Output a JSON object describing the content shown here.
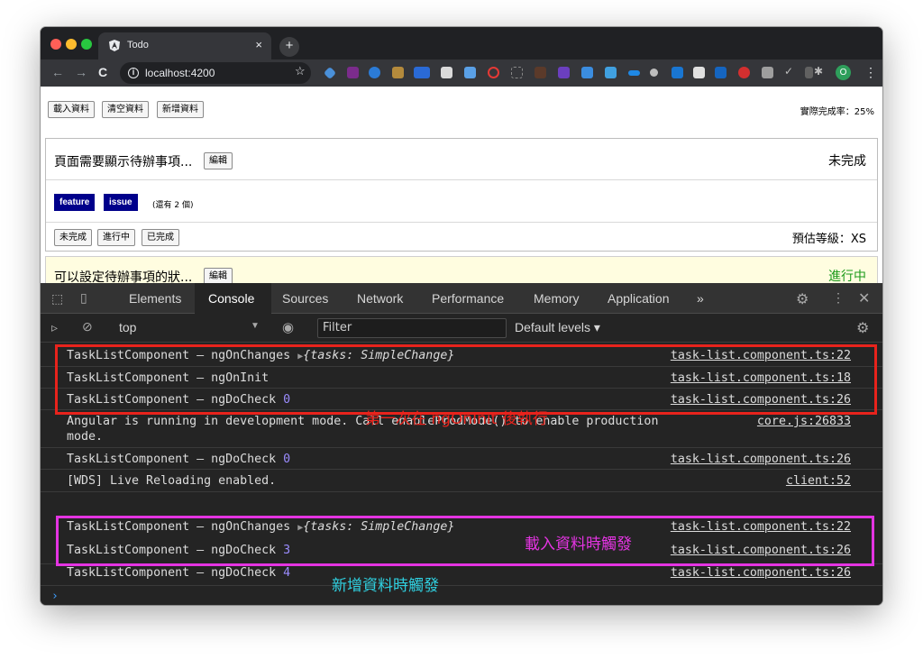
{
  "browser": {
    "tab_title": "Todo",
    "tab_close": "×",
    "new_tab": "+",
    "url": "localhost:4200",
    "avatar_letter": "O",
    "nav": {
      "back": "←",
      "forward": "→",
      "reload": "C"
    }
  },
  "page": {
    "buttons": [
      "載入資料",
      "清空資料",
      "新增資料"
    ],
    "completion_rate": "實際完成率：25%",
    "task1": {
      "title": "頁面需要顯示待辦事項...",
      "edit_label": "編輯",
      "status": "未完成",
      "tags": [
        "feature",
        "issue"
      ],
      "remaining": "(還有 2 個)",
      "state_buttons": [
        "未完成",
        "進行中",
        "已完成"
      ],
      "estimate": "預估等級：XS"
    },
    "task2": {
      "title": "可以設定待辦事項的狀...",
      "edit_label": "編輯",
      "status": "進行中",
      "status_color": "#1a9a1a"
    }
  },
  "devtools": {
    "tabs": [
      "Elements",
      "Console",
      "Sources",
      "Network",
      "Performance",
      "Memory",
      "Application"
    ],
    "more_tabs": "»",
    "active_tab": "Console",
    "context": "top",
    "filter_placeholder": "Filter",
    "levels": "Default levels ▾",
    "logs": [
      {
        "prefix": "TaskListComponent – ngOnChanges ",
        "object": "{tasks: SimpleChange}",
        "source": "task-list.component.ts:22"
      },
      {
        "prefix": "TaskListComponent – ngOnInit",
        "source": "task-list.component.ts:18"
      },
      {
        "prefix": "TaskListComponent – ngDoCheck ",
        "num": "0",
        "source": "task-list.component.ts:26"
      },
      {
        "prefix": "Angular is running in development mode. Call enableProdMode() to enable production\nmode.",
        "source": "core.js:26833"
      },
      {
        "prefix": "TaskListComponent – ngDoCheck ",
        "num": "0",
        "source": "task-list.component.ts:26"
      },
      {
        "prefix": "[WDS] Live Reloading enabled.",
        "source": "client:52"
      },
      {
        "prefix": "TaskListComponent – ngOnChanges ",
        "object": "{tasks: SimpleChange}",
        "source": "task-list.component.ts:22"
      },
      {
        "prefix": "TaskListComponent – ngDoCheck ",
        "num": "3",
        "source": "task-list.component.ts:26"
      },
      {
        "prefix": "TaskListComponent – ngDoCheck ",
        "num": "4",
        "source": "task-list.component.ts:26"
      }
    ],
    "prompt": "›"
  },
  "annotations": {
    "red_note": "第一次在 ngOnInit 後執行",
    "pink_note": "載入資料時觸發",
    "cyan_note": "新增資料時觸發",
    "colors": {
      "red": "#e8231c",
      "pink": "#e434e2",
      "cyan": "#2fd0e0"
    }
  }
}
